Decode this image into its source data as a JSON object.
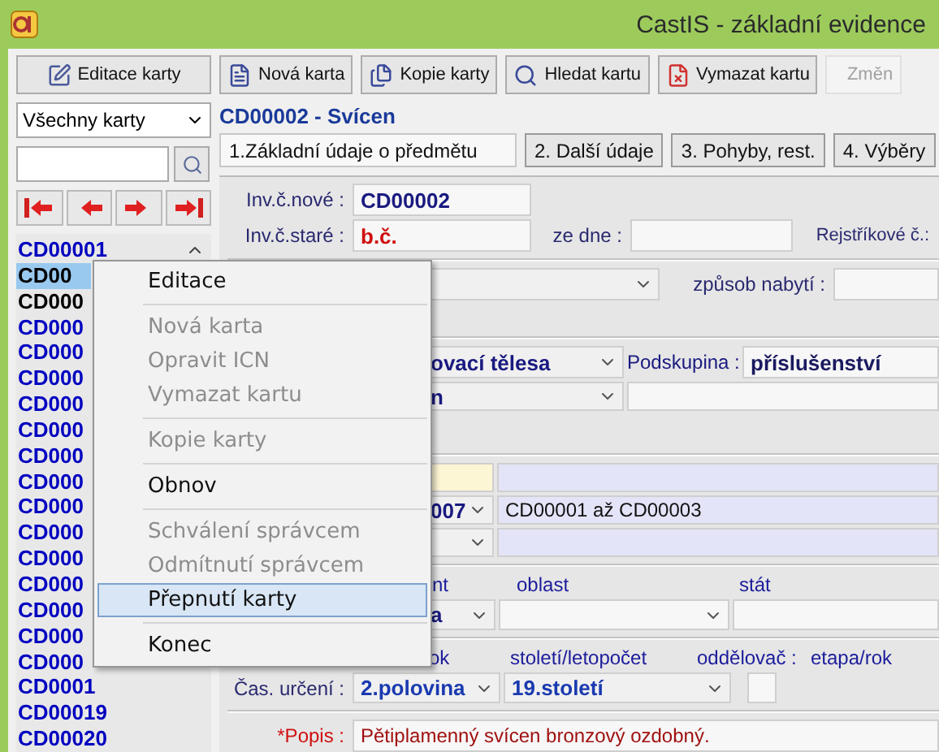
{
  "window": {
    "title": "CastIS - základní evidence"
  },
  "toolbar": [
    {
      "label": "Editace karty",
      "disabled": false
    },
    {
      "label": "Nová karta",
      "disabled": false
    },
    {
      "label": "Kopie karty",
      "disabled": false
    },
    {
      "label": "Hledat kartu",
      "disabled": false
    },
    {
      "label": "Vymazat kartu",
      "disabled": false
    },
    {
      "label": "Změn",
      "disabled": true
    }
  ],
  "filter": {
    "value": "Všechny karty"
  },
  "cards": [
    {
      "label": "CD00001",
      "selected": false,
      "color": "#0000c0"
    },
    {
      "label": "CD00",
      "selected": true,
      "color": "#000000"
    },
    {
      "label": "CD000",
      "selected": false,
      "color": "#000000"
    },
    {
      "label": "CD000",
      "selected": false,
      "color": "#0000c0"
    },
    {
      "label": "CD000",
      "selected": false,
      "color": "#0000c0"
    },
    {
      "label": "CD000",
      "selected": false,
      "color": "#0000c0"
    },
    {
      "label": "CD000",
      "selected": false,
      "color": "#0000c0"
    },
    {
      "label": "CD000",
      "selected": false,
      "color": "#0000c0"
    },
    {
      "label": "CD000",
      "selected": false,
      "color": "#0000c0"
    },
    {
      "label": "CD000",
      "selected": false,
      "color": "#0000c0"
    },
    {
      "label": "CD000",
      "selected": false,
      "color": "#0000c0"
    },
    {
      "label": "CD000",
      "selected": false,
      "color": "#0000c0"
    },
    {
      "label": "CD000",
      "selected": false,
      "color": "#0000c0"
    },
    {
      "label": "CD000",
      "selected": false,
      "color": "#0000c0"
    },
    {
      "label": "CD000",
      "selected": false,
      "color": "#0000c0"
    },
    {
      "label": "CD000",
      "selected": false,
      "color": "#0000c0"
    },
    {
      "label": "CD000",
      "selected": false,
      "color": "#0000c0"
    },
    {
      "label": "CD0001",
      "selected": false,
      "color": "#0000c0"
    },
    {
      "label": "CD00019",
      "selected": false,
      "color": "#0000c0"
    },
    {
      "label": "CD00020",
      "selected": false,
      "color": "#0000c0"
    }
  ],
  "card_header": "CD00002 - Svícen",
  "tabs": [
    {
      "label": "1.Základní údaje o předmětu",
      "selected": true
    },
    {
      "label": "2. Další údaje",
      "selected": false
    },
    {
      "label": "3. Pohyby, rest.",
      "selected": false
    },
    {
      "label": "4. Výběry",
      "selected": false
    }
  ],
  "form": {
    "inv_new": {
      "label": "Inv.č.nové :",
      "value": "CD00002"
    },
    "inv_old": {
      "label": "Inv.č.staré :",
      "value": "b.č."
    },
    "date_label": "ze dne :",
    "register_label": "Rejstříkové č.:",
    "acquisition_label": "způsob nabytí :",
    "group": "ovací tělesa",
    "subgroup": {
      "label": "Podskupina :",
      "value": "příslušenství"
    },
    "row_6": "n",
    "range_code": "007",
    "range": "CD00001 až CD00003",
    "place_labels": [
      "nt",
      "oblast",
      "stát"
    ],
    "place_value": "a",
    "dating_labels": [
      "ok",
      "století/letopočet",
      "oddělovač :",
      "etapa/rok"
    ],
    "dating": {
      "label": "Čas. určení :",
      "values": [
        "2.polovina",
        "19.století"
      ]
    },
    "description": {
      "label": "*Popis :",
      "value": "Pětiplamenný svícen bronzový ozdobný."
    }
  },
  "context_menu": [
    {
      "kind": "item",
      "label": "Editace",
      "disabled": false,
      "selected": false
    },
    {
      "kind": "separator"
    },
    {
      "kind": "item",
      "label": "Nová karta",
      "disabled": true,
      "selected": false
    },
    {
      "kind": "item",
      "label": "Opravit ICN",
      "disabled": true,
      "selected": false
    },
    {
      "kind": "item",
      "label": "Vymazat kartu",
      "disabled": true,
      "selected": false
    },
    {
      "kind": "separator"
    },
    {
      "kind": "item",
      "label": "Kopie karty",
      "disabled": true,
      "selected": false
    },
    {
      "kind": "separator"
    },
    {
      "kind": "item",
      "label": "Obnov",
      "disabled": false,
      "selected": false
    },
    {
      "kind": "separator"
    },
    {
      "kind": "item",
      "label": "Schválení správcem",
      "disabled": true,
      "selected": false
    },
    {
      "kind": "item",
      "label": "Odmítnutí správcem",
      "disabled": true,
      "selected": false
    },
    {
      "kind": "item",
      "label": "Přepnutí karty",
      "disabled": false,
      "selected": true
    },
    {
      "kind": "separator"
    },
    {
      "kind": "item",
      "label": "Konec",
      "disabled": false,
      "selected": false
    }
  ]
}
